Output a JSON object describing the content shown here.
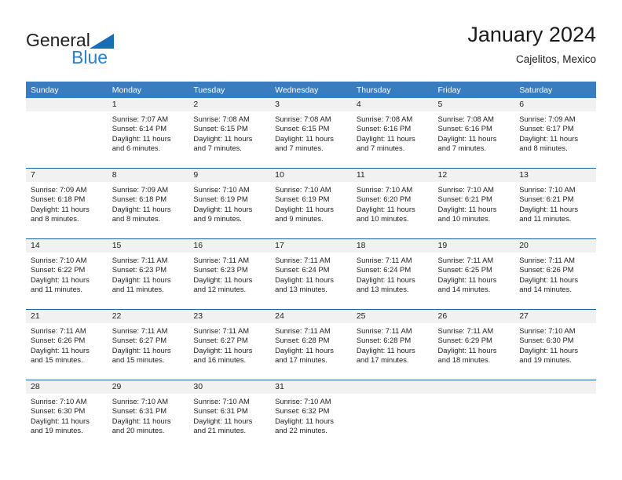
{
  "brand": {
    "name_top": "General",
    "name_bottom": "Blue",
    "triangle_color": "#1b6cb5",
    "blue_color": "#2a7fd4"
  },
  "header": {
    "title": "January 2024",
    "subtitle": "Cajelitos, Mexico"
  },
  "theme": {
    "header_blue": "#3a7cc0",
    "separator_blue": "#1b63ab",
    "daynum_gray": "#f1f1f1"
  },
  "weekday_headers": [
    "Sunday",
    "Monday",
    "Tuesday",
    "Wednesday",
    "Thursday",
    "Friday",
    "Saturday"
  ],
  "weeks": [
    [
      {
        "day": "",
        "sunrise": "",
        "sunset": "",
        "daylight1": "",
        "daylight2": ""
      },
      {
        "day": "1",
        "sunrise": "Sunrise: 7:07 AM",
        "sunset": "Sunset: 6:14 PM",
        "daylight1": "Daylight: 11 hours",
        "daylight2": "and 6 minutes."
      },
      {
        "day": "2",
        "sunrise": "Sunrise: 7:08 AM",
        "sunset": "Sunset: 6:15 PM",
        "daylight1": "Daylight: 11 hours",
        "daylight2": "and 7 minutes."
      },
      {
        "day": "3",
        "sunrise": "Sunrise: 7:08 AM",
        "sunset": "Sunset: 6:15 PM",
        "daylight1": "Daylight: 11 hours",
        "daylight2": "and 7 minutes."
      },
      {
        "day": "4",
        "sunrise": "Sunrise: 7:08 AM",
        "sunset": "Sunset: 6:16 PM",
        "daylight1": "Daylight: 11 hours",
        "daylight2": "and 7 minutes."
      },
      {
        "day": "5",
        "sunrise": "Sunrise: 7:08 AM",
        "sunset": "Sunset: 6:16 PM",
        "daylight1": "Daylight: 11 hours",
        "daylight2": "and 7 minutes."
      },
      {
        "day": "6",
        "sunrise": "Sunrise: 7:09 AM",
        "sunset": "Sunset: 6:17 PM",
        "daylight1": "Daylight: 11 hours",
        "daylight2": "and 8 minutes."
      }
    ],
    [
      {
        "day": "7",
        "sunrise": "Sunrise: 7:09 AM",
        "sunset": "Sunset: 6:18 PM",
        "daylight1": "Daylight: 11 hours",
        "daylight2": "and 8 minutes."
      },
      {
        "day": "8",
        "sunrise": "Sunrise: 7:09 AM",
        "sunset": "Sunset: 6:18 PM",
        "daylight1": "Daylight: 11 hours",
        "daylight2": "and 8 minutes."
      },
      {
        "day": "9",
        "sunrise": "Sunrise: 7:10 AM",
        "sunset": "Sunset: 6:19 PM",
        "daylight1": "Daylight: 11 hours",
        "daylight2": "and 9 minutes."
      },
      {
        "day": "10",
        "sunrise": "Sunrise: 7:10 AM",
        "sunset": "Sunset: 6:19 PM",
        "daylight1": "Daylight: 11 hours",
        "daylight2": "and 9 minutes."
      },
      {
        "day": "11",
        "sunrise": "Sunrise: 7:10 AM",
        "sunset": "Sunset: 6:20 PM",
        "daylight1": "Daylight: 11 hours",
        "daylight2": "and 10 minutes."
      },
      {
        "day": "12",
        "sunrise": "Sunrise: 7:10 AM",
        "sunset": "Sunset: 6:21 PM",
        "daylight1": "Daylight: 11 hours",
        "daylight2": "and 10 minutes."
      },
      {
        "day": "13",
        "sunrise": "Sunrise: 7:10 AM",
        "sunset": "Sunset: 6:21 PM",
        "daylight1": "Daylight: 11 hours",
        "daylight2": "and 11 minutes."
      }
    ],
    [
      {
        "day": "14",
        "sunrise": "Sunrise: 7:10 AM",
        "sunset": "Sunset: 6:22 PM",
        "daylight1": "Daylight: 11 hours",
        "daylight2": "and 11 minutes."
      },
      {
        "day": "15",
        "sunrise": "Sunrise: 7:11 AM",
        "sunset": "Sunset: 6:23 PM",
        "daylight1": "Daylight: 11 hours",
        "daylight2": "and 11 minutes."
      },
      {
        "day": "16",
        "sunrise": "Sunrise: 7:11 AM",
        "sunset": "Sunset: 6:23 PM",
        "daylight1": "Daylight: 11 hours",
        "daylight2": "and 12 minutes."
      },
      {
        "day": "17",
        "sunrise": "Sunrise: 7:11 AM",
        "sunset": "Sunset: 6:24 PM",
        "daylight1": "Daylight: 11 hours",
        "daylight2": "and 13 minutes."
      },
      {
        "day": "18",
        "sunrise": "Sunrise: 7:11 AM",
        "sunset": "Sunset: 6:24 PM",
        "daylight1": "Daylight: 11 hours",
        "daylight2": "and 13 minutes."
      },
      {
        "day": "19",
        "sunrise": "Sunrise: 7:11 AM",
        "sunset": "Sunset: 6:25 PM",
        "daylight1": "Daylight: 11 hours",
        "daylight2": "and 14 minutes."
      },
      {
        "day": "20",
        "sunrise": "Sunrise: 7:11 AM",
        "sunset": "Sunset: 6:26 PM",
        "daylight1": "Daylight: 11 hours",
        "daylight2": "and 14 minutes."
      }
    ],
    [
      {
        "day": "21",
        "sunrise": "Sunrise: 7:11 AM",
        "sunset": "Sunset: 6:26 PM",
        "daylight1": "Daylight: 11 hours",
        "daylight2": "and 15 minutes."
      },
      {
        "day": "22",
        "sunrise": "Sunrise: 7:11 AM",
        "sunset": "Sunset: 6:27 PM",
        "daylight1": "Daylight: 11 hours",
        "daylight2": "and 15 minutes."
      },
      {
        "day": "23",
        "sunrise": "Sunrise: 7:11 AM",
        "sunset": "Sunset: 6:27 PM",
        "daylight1": "Daylight: 11 hours",
        "daylight2": "and 16 minutes."
      },
      {
        "day": "24",
        "sunrise": "Sunrise: 7:11 AM",
        "sunset": "Sunset: 6:28 PM",
        "daylight1": "Daylight: 11 hours",
        "daylight2": "and 17 minutes."
      },
      {
        "day": "25",
        "sunrise": "Sunrise: 7:11 AM",
        "sunset": "Sunset: 6:28 PM",
        "daylight1": "Daylight: 11 hours",
        "daylight2": "and 17 minutes."
      },
      {
        "day": "26",
        "sunrise": "Sunrise: 7:11 AM",
        "sunset": "Sunset: 6:29 PM",
        "daylight1": "Daylight: 11 hours",
        "daylight2": "and 18 minutes."
      },
      {
        "day": "27",
        "sunrise": "Sunrise: 7:10 AM",
        "sunset": "Sunset: 6:30 PM",
        "daylight1": "Daylight: 11 hours",
        "daylight2": "and 19 minutes."
      }
    ],
    [
      {
        "day": "28",
        "sunrise": "Sunrise: 7:10 AM",
        "sunset": "Sunset: 6:30 PM",
        "daylight1": "Daylight: 11 hours",
        "daylight2": "and 19 minutes."
      },
      {
        "day": "29",
        "sunrise": "Sunrise: 7:10 AM",
        "sunset": "Sunset: 6:31 PM",
        "daylight1": "Daylight: 11 hours",
        "daylight2": "and 20 minutes."
      },
      {
        "day": "30",
        "sunrise": "Sunrise: 7:10 AM",
        "sunset": "Sunset: 6:31 PM",
        "daylight1": "Daylight: 11 hours",
        "daylight2": "and 21 minutes."
      },
      {
        "day": "31",
        "sunrise": "Sunrise: 7:10 AM",
        "sunset": "Sunset: 6:32 PM",
        "daylight1": "Daylight: 11 hours",
        "daylight2": "and 22 minutes."
      },
      {
        "day": "",
        "sunrise": "",
        "sunset": "",
        "daylight1": "",
        "daylight2": ""
      },
      {
        "day": "",
        "sunrise": "",
        "sunset": "",
        "daylight1": "",
        "daylight2": ""
      },
      {
        "day": "",
        "sunrise": "",
        "sunset": "",
        "daylight1": "",
        "daylight2": ""
      }
    ]
  ]
}
